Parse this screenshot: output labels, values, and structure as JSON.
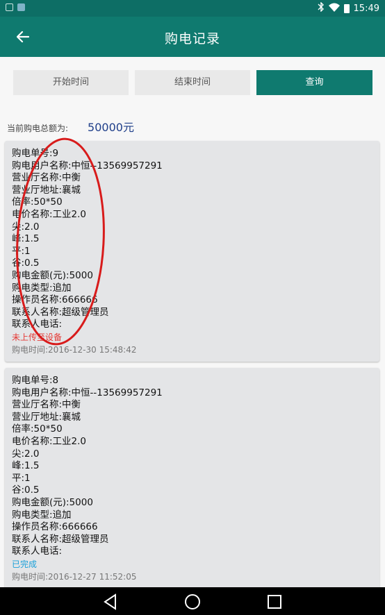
{
  "status_bar": {
    "time": "15:49"
  },
  "app_bar": {
    "title": "购电记录",
    "back_icon": "arrow-left-icon"
  },
  "filters": {
    "start_label": "开始时间",
    "end_label": "结束时间",
    "query_label": "查询"
  },
  "summary": {
    "label": "当前购电总额为:",
    "value": "50000元"
  },
  "records": [
    {
      "lines": [
        "购电单号:9",
        "购电用户名称:中恒--13569957291",
        "营业厅名称:中衡",
        "营业厅地址:襄城",
        "倍率:50*50",
        "电价名称:工业2.0",
        "尖:2.0",
        "峰:1.5",
        "平:1",
        "谷:0.5",
        "购电金额(元):5000",
        "购电类型:追加",
        "操作员名称:666666",
        "联系人名称:超级管理员",
        "联系人电话:"
      ],
      "status": "未上传至设备",
      "status_color": "#e53935",
      "time": "购电时间:2016-12-30 15:48:42"
    },
    {
      "lines": [
        "购电单号:8",
        "购电用户名称:中恒--13569957291",
        "营业厅名称:中衡",
        "营业厅地址:襄城",
        "倍率:50*50",
        "电价名称:工业2.0",
        "尖:2.0",
        "峰:1.5",
        "平:1",
        "谷:0.5",
        "购电金额(元):5000",
        "购电类型:追加",
        "操作员名称:666666",
        "联系人名称:超级管理员",
        "联系人电话:"
      ],
      "status": "已完成",
      "status_color": "#1aa0d8",
      "time": "购电时间:2016-12-27 11:52:05"
    }
  ],
  "colors": {
    "primary": "#0f7a6f",
    "status_bar": "#0d6e65",
    "amount": "#1f3f8a",
    "annotation": "#d81b1b"
  },
  "nav_bar": {
    "back_icon": "triangle-back-icon",
    "home_icon": "circle-home-icon",
    "recents_icon": "square-recents-icon"
  }
}
